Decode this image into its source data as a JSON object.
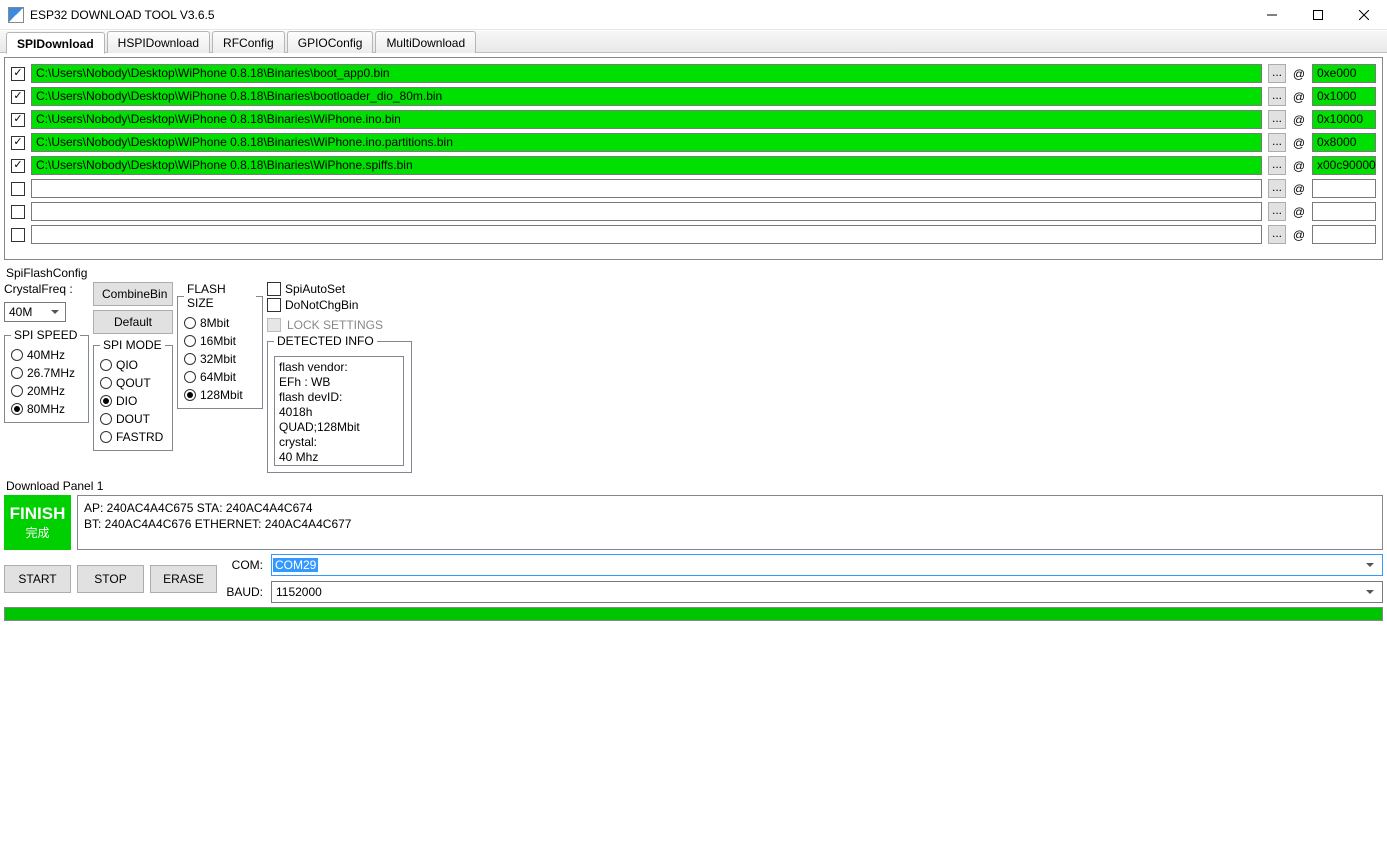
{
  "window": {
    "title": "ESP32 DOWNLOAD TOOL V3.6.5"
  },
  "tabs": [
    "SPIDownload",
    "HSPIDownload",
    "RFConfig",
    "GPIOConfig",
    "MultiDownload"
  ],
  "activeTab": "SPIDownload",
  "files": [
    {
      "checked": true,
      "path": "C:\\Users\\Nobody\\Desktop\\WiPhone 0.8.18\\Binaries\\boot_app0.bin",
      "addr": "0xe000"
    },
    {
      "checked": true,
      "path": "C:\\Users\\Nobody\\Desktop\\WiPhone 0.8.18\\Binaries\\bootloader_dio_80m.bin",
      "addr": "0x1000"
    },
    {
      "checked": true,
      "path": "C:\\Users\\Nobody\\Desktop\\WiPhone 0.8.18\\Binaries\\WiPhone.ino.bin",
      "addr": "0x10000"
    },
    {
      "checked": true,
      "path": "C:\\Users\\Nobody\\Desktop\\WiPhone 0.8.18\\Binaries\\WiPhone.ino.partitions.bin",
      "addr": "0x8000"
    },
    {
      "checked": true,
      "path": "C:\\Users\\Nobody\\Desktop\\WiPhone 0.8.18\\Binaries\\WiPhone.spiffs.bin",
      "addr": "x00c90000"
    },
    {
      "checked": false,
      "path": "",
      "addr": ""
    },
    {
      "checked": false,
      "path": "",
      "addr": ""
    },
    {
      "checked": false,
      "path": "",
      "addr": ""
    }
  ],
  "spiFlashConfigLabel": "SpiFlashConfig",
  "crystal": {
    "label": "CrystalFreq :",
    "value": "40M"
  },
  "buttons": {
    "combine": "CombineBin",
    "default": "Default"
  },
  "spiSpeed": {
    "label": "SPI SPEED",
    "options": [
      "40MHz",
      "26.7MHz",
      "20MHz",
      "80MHz"
    ],
    "selected": "80MHz"
  },
  "spiMode": {
    "label": "SPI MODE",
    "options": [
      "QIO",
      "QOUT",
      "DIO",
      "DOUT",
      "FASTRD"
    ],
    "selected": "DIO"
  },
  "flashSize": {
    "label": "FLASH SIZE",
    "options": [
      "8Mbit",
      "16Mbit",
      "32Mbit",
      "64Mbit",
      "128Mbit"
    ],
    "selected": "128Mbit"
  },
  "misc": {
    "spiAutoSet": "SpiAutoSet",
    "doNotChg": "DoNotChgBin",
    "lock": "LOCK SETTINGS"
  },
  "detected": {
    "label": "DETECTED INFO",
    "text": "flash vendor:\nEFh : WB\nflash devID:\n4018h\nQUAD;128Mbit\ncrystal:\n40 Mhz"
  },
  "downloadPanelLabel": "Download Panel 1",
  "finish": {
    "en": "FINISH",
    "cn": "完成"
  },
  "mac": {
    "line1": "AP:  240AC4A4C675  STA:  240AC4A4C674",
    "line2": "BT:  240AC4A4C676  ETHERNET:  240AC4A4C677"
  },
  "actions": {
    "start": "START",
    "stop": "STOP",
    "erase": "ERASE"
  },
  "com": {
    "label": "COM:",
    "value": "COM29"
  },
  "baud": {
    "label": "BAUD:",
    "value": "1152000"
  },
  "browseBtn": "...",
  "atSymbol": "@"
}
